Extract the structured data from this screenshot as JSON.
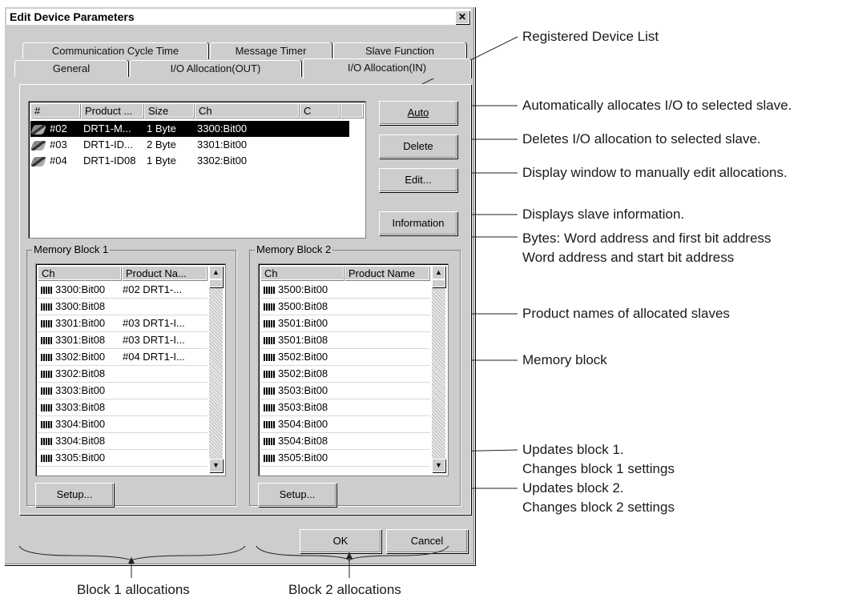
{
  "window": {
    "title": "Edit Device Parameters",
    "close": "✕"
  },
  "tabs_back": [
    "Communication Cycle Time",
    "Message Timer",
    "Slave Function"
  ],
  "tabs_front": [
    "General",
    "I/O Allocation(OUT)",
    "I/O Allocation(IN)"
  ],
  "device_list": {
    "columns": [
      "#",
      "Product ...",
      "Size",
      "Ch",
      "C"
    ],
    "rows": [
      {
        "num": "#02",
        "product": "DRT1-M...",
        "size": "1 Byte",
        "ch": "3300:Bit00",
        "selected": true
      },
      {
        "num": "#03",
        "product": "DRT1-ID...",
        "size": "2 Byte",
        "ch": "3301:Bit00",
        "selected": false
      },
      {
        "num": "#04",
        "product": "DRT1-ID08",
        "size": "1 Byte",
        "ch": "3302:Bit00",
        "selected": false
      }
    ]
  },
  "buttons": {
    "auto": "Auto",
    "delete": "Delete",
    "edit": "Edit...",
    "information": "Information",
    "setup1": "Setup...",
    "setup2": "Setup...",
    "ok": "OK",
    "cancel": "Cancel"
  },
  "block1": {
    "label": "Memory Block 1",
    "columns": [
      "Ch",
      "Product Na..."
    ],
    "rows": [
      {
        "ch": "3300:Bit00",
        "pn": "#02 DRT1-..."
      },
      {
        "ch": "3300:Bit08",
        "pn": ""
      },
      {
        "ch": "3301:Bit00",
        "pn": "#03 DRT1-I..."
      },
      {
        "ch": "3301:Bit08",
        "pn": "#03 DRT1-I..."
      },
      {
        "ch": "3302:Bit00",
        "pn": "#04 DRT1-I..."
      },
      {
        "ch": "3302:Bit08",
        "pn": ""
      },
      {
        "ch": "3303:Bit00",
        "pn": ""
      },
      {
        "ch": "3303:Bit08",
        "pn": ""
      },
      {
        "ch": "3304:Bit00",
        "pn": ""
      },
      {
        "ch": "3304:Bit08",
        "pn": ""
      },
      {
        "ch": "3305:Bit00",
        "pn": ""
      }
    ]
  },
  "block2": {
    "label": "Memory Block 2",
    "columns": [
      "Ch",
      "Product Name"
    ],
    "rows": [
      {
        "ch": "3500:Bit00",
        "pn": ""
      },
      {
        "ch": "3500:Bit08",
        "pn": ""
      },
      {
        "ch": "3501:Bit00",
        "pn": ""
      },
      {
        "ch": "3501:Bit08",
        "pn": ""
      },
      {
        "ch": "3502:Bit00",
        "pn": ""
      },
      {
        "ch": "3502:Bit08",
        "pn": ""
      },
      {
        "ch": "3503:Bit00",
        "pn": ""
      },
      {
        "ch": "3503:Bit08",
        "pn": ""
      },
      {
        "ch": "3504:Bit00",
        "pn": ""
      },
      {
        "ch": "3504:Bit08",
        "pn": ""
      },
      {
        "ch": "3505:Bit00",
        "pn": ""
      }
    ]
  },
  "annotations": {
    "registered_list": "Registered Device List",
    "auto": "Automatically allocates I/O to selected slave.",
    "delete": "Deletes I/O allocation to selected slave.",
    "edit": "Display window to manually edit allocations.",
    "info": "Displays slave information.",
    "bytes1": "Bytes: Word address and first bit address",
    "bytes2": "Word address and start bit address",
    "product_names": "Product names of allocated slaves",
    "memory_block": "Memory block",
    "upd1a": "Updates block 1.",
    "upd1b": "Changes block 1 settings",
    "upd2a": "Updates block 2.",
    "upd2b": "Changes block 2 settings",
    "block1_alloc": "Block 1 allocations",
    "block2_alloc": "Block 2 allocations"
  }
}
